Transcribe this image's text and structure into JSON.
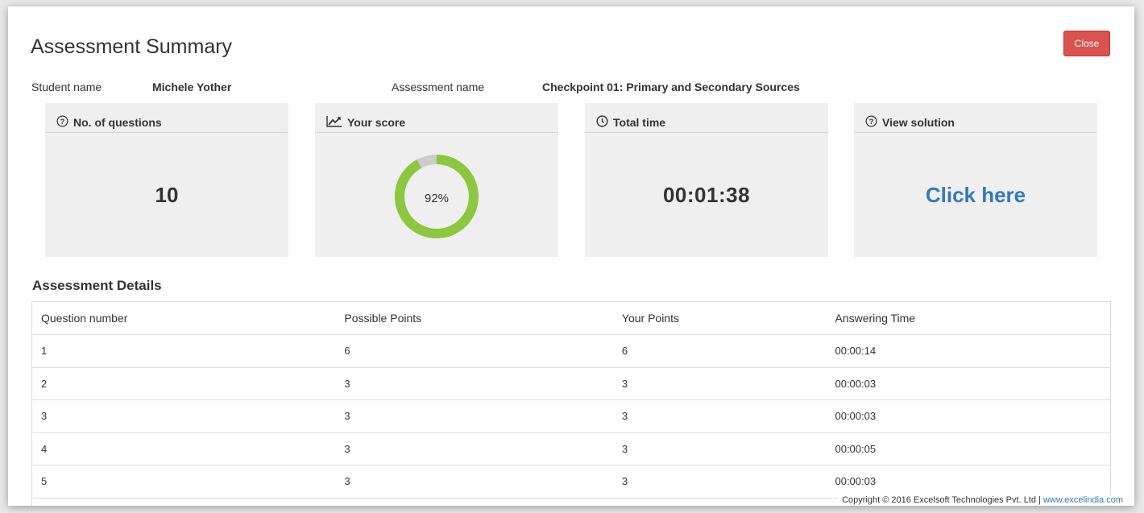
{
  "header": {
    "title": "Assessment Summary",
    "close_label": "Close"
  },
  "info": {
    "student_label": "Student name",
    "student_value": "Michele Yother",
    "assessment_label": "Assessment name",
    "assessment_value": "Checkpoint 01: Primary and Secondary Sources"
  },
  "cards": {
    "questions": {
      "title": "No. of questions",
      "value": "10",
      "icon": "question-circle-icon"
    },
    "score": {
      "title": "Your score",
      "value": "92%",
      "percent": 92,
      "icon": "line-chart-icon",
      "ring_color": "#8dc63f",
      "track_color": "#cccccc"
    },
    "time": {
      "title": "Total time",
      "value": "00:01:38",
      "icon": "clock-icon"
    },
    "solution": {
      "title": "View solution",
      "link": "Click here",
      "icon": "question-circle-icon",
      "link_color": "#337ab7"
    }
  },
  "details": {
    "title": "Assessment Details",
    "columns": [
      "Question number",
      "Possible Points",
      "Your Points",
      "Answering Time"
    ],
    "rows": [
      [
        "1",
        "6",
        "6",
        "00:00:14"
      ],
      [
        "2",
        "3",
        "3",
        "00:00:03"
      ],
      [
        "3",
        "3",
        "3",
        "00:00:03"
      ],
      [
        "4",
        "3",
        "3",
        "00:00:05"
      ],
      [
        "5",
        "3",
        "3",
        "00:00:03"
      ]
    ]
  },
  "footer": {
    "copyright": "Copyright © 2016 Excelsoft Technologies Pvt. Ltd | ",
    "link": "www.excelindia.com"
  },
  "colors": {
    "close_button": "#d9534f",
    "card_bg": "#efefef"
  }
}
